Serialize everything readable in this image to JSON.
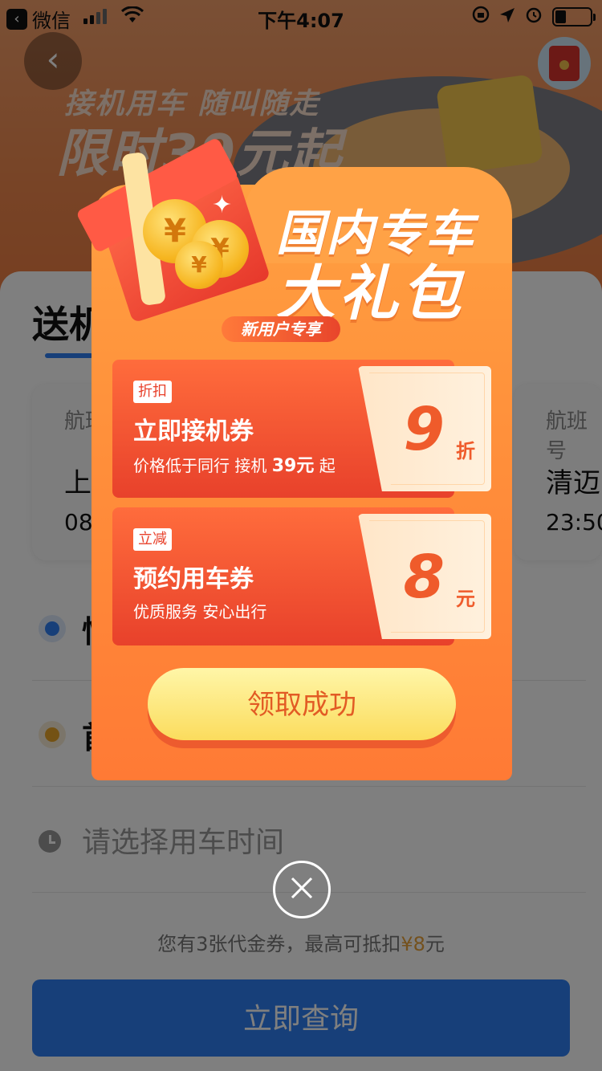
{
  "status_bar": {
    "back_app": "微信",
    "time": "下午4:07"
  },
  "banner": {
    "line1": "接机用车 随叫随走",
    "line2": "限时39元起"
  },
  "page": {
    "tab_title": "送机",
    "flight_left": {
      "label": "航班",
      "city": "上",
      "time": "08"
    },
    "flight_right": {
      "label": "航班号",
      "city": "清迈",
      "time": "23:50"
    },
    "row1_text": "怡",
    "row2_text": "首",
    "time_placeholder": "请选择用车时间",
    "voucher_note_prefix": "您有3张代金券，最高可抵扣",
    "voucher_note_amount": "¥8",
    "voucher_note_suffix": "元",
    "query_button": "立即查询"
  },
  "popup": {
    "title_line1": "国内专车",
    "title_line2": "大礼包",
    "badge": "新用户专享",
    "coupons": [
      {
        "tag": "折扣",
        "name": "立即接机券",
        "desc_prefix": "价格低于同行  接机 ",
        "desc_bold": "39元",
        "desc_suffix": " 起",
        "value": "9",
        "unit": "折"
      },
      {
        "tag": "立减",
        "name": "预约用车券",
        "desc": "优质服务  安心出行",
        "value": "8",
        "unit": "元"
      }
    ],
    "claim_button": "领取成功"
  },
  "colors": {
    "accent_blue": "#2f7ff2",
    "popup_orange": "#ff8d3a",
    "coupon_red": "#e8412b",
    "claim_text": "#e25b24"
  }
}
